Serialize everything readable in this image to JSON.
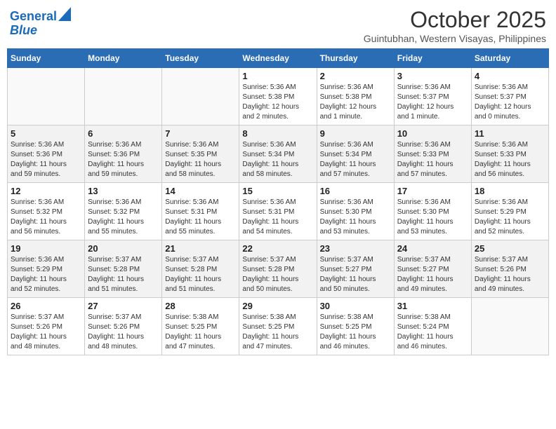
{
  "header": {
    "logo_line1": "General",
    "logo_line2": "Blue",
    "month": "October 2025",
    "location": "Guintubhan, Western Visayas, Philippines"
  },
  "weekdays": [
    "Sunday",
    "Monday",
    "Tuesday",
    "Wednesday",
    "Thursday",
    "Friday",
    "Saturday"
  ],
  "weeks": [
    [
      {
        "day": "",
        "info": ""
      },
      {
        "day": "",
        "info": ""
      },
      {
        "day": "",
        "info": ""
      },
      {
        "day": "1",
        "info": "Sunrise: 5:36 AM\nSunset: 5:38 PM\nDaylight: 12 hours\nand 2 minutes."
      },
      {
        "day": "2",
        "info": "Sunrise: 5:36 AM\nSunset: 5:38 PM\nDaylight: 12 hours\nand 1 minute."
      },
      {
        "day": "3",
        "info": "Sunrise: 5:36 AM\nSunset: 5:37 PM\nDaylight: 12 hours\nand 1 minute."
      },
      {
        "day": "4",
        "info": "Sunrise: 5:36 AM\nSunset: 5:37 PM\nDaylight: 12 hours\nand 0 minutes."
      }
    ],
    [
      {
        "day": "5",
        "info": "Sunrise: 5:36 AM\nSunset: 5:36 PM\nDaylight: 11 hours\nand 59 minutes."
      },
      {
        "day": "6",
        "info": "Sunrise: 5:36 AM\nSunset: 5:36 PM\nDaylight: 11 hours\nand 59 minutes."
      },
      {
        "day": "7",
        "info": "Sunrise: 5:36 AM\nSunset: 5:35 PM\nDaylight: 11 hours\nand 58 minutes."
      },
      {
        "day": "8",
        "info": "Sunrise: 5:36 AM\nSunset: 5:34 PM\nDaylight: 11 hours\nand 58 minutes."
      },
      {
        "day": "9",
        "info": "Sunrise: 5:36 AM\nSunset: 5:34 PM\nDaylight: 11 hours\nand 57 minutes."
      },
      {
        "day": "10",
        "info": "Sunrise: 5:36 AM\nSunset: 5:33 PM\nDaylight: 11 hours\nand 57 minutes."
      },
      {
        "day": "11",
        "info": "Sunrise: 5:36 AM\nSunset: 5:33 PM\nDaylight: 11 hours\nand 56 minutes."
      }
    ],
    [
      {
        "day": "12",
        "info": "Sunrise: 5:36 AM\nSunset: 5:32 PM\nDaylight: 11 hours\nand 56 minutes."
      },
      {
        "day": "13",
        "info": "Sunrise: 5:36 AM\nSunset: 5:32 PM\nDaylight: 11 hours\nand 55 minutes."
      },
      {
        "day": "14",
        "info": "Sunrise: 5:36 AM\nSunset: 5:31 PM\nDaylight: 11 hours\nand 55 minutes."
      },
      {
        "day": "15",
        "info": "Sunrise: 5:36 AM\nSunset: 5:31 PM\nDaylight: 11 hours\nand 54 minutes."
      },
      {
        "day": "16",
        "info": "Sunrise: 5:36 AM\nSunset: 5:30 PM\nDaylight: 11 hours\nand 53 minutes."
      },
      {
        "day": "17",
        "info": "Sunrise: 5:36 AM\nSunset: 5:30 PM\nDaylight: 11 hours\nand 53 minutes."
      },
      {
        "day": "18",
        "info": "Sunrise: 5:36 AM\nSunset: 5:29 PM\nDaylight: 11 hours\nand 52 minutes."
      }
    ],
    [
      {
        "day": "19",
        "info": "Sunrise: 5:36 AM\nSunset: 5:29 PM\nDaylight: 11 hours\nand 52 minutes."
      },
      {
        "day": "20",
        "info": "Sunrise: 5:37 AM\nSunset: 5:28 PM\nDaylight: 11 hours\nand 51 minutes."
      },
      {
        "day": "21",
        "info": "Sunrise: 5:37 AM\nSunset: 5:28 PM\nDaylight: 11 hours\nand 51 minutes."
      },
      {
        "day": "22",
        "info": "Sunrise: 5:37 AM\nSunset: 5:28 PM\nDaylight: 11 hours\nand 50 minutes."
      },
      {
        "day": "23",
        "info": "Sunrise: 5:37 AM\nSunset: 5:27 PM\nDaylight: 11 hours\nand 50 minutes."
      },
      {
        "day": "24",
        "info": "Sunrise: 5:37 AM\nSunset: 5:27 PM\nDaylight: 11 hours\nand 49 minutes."
      },
      {
        "day": "25",
        "info": "Sunrise: 5:37 AM\nSunset: 5:26 PM\nDaylight: 11 hours\nand 49 minutes."
      }
    ],
    [
      {
        "day": "26",
        "info": "Sunrise: 5:37 AM\nSunset: 5:26 PM\nDaylight: 11 hours\nand 48 minutes."
      },
      {
        "day": "27",
        "info": "Sunrise: 5:37 AM\nSunset: 5:26 PM\nDaylight: 11 hours\nand 48 minutes."
      },
      {
        "day": "28",
        "info": "Sunrise: 5:38 AM\nSunset: 5:25 PM\nDaylight: 11 hours\nand 47 minutes."
      },
      {
        "day": "29",
        "info": "Sunrise: 5:38 AM\nSunset: 5:25 PM\nDaylight: 11 hours\nand 47 minutes."
      },
      {
        "day": "30",
        "info": "Sunrise: 5:38 AM\nSunset: 5:25 PM\nDaylight: 11 hours\nand 46 minutes."
      },
      {
        "day": "31",
        "info": "Sunrise: 5:38 AM\nSunset: 5:24 PM\nDaylight: 11 hours\nand 46 minutes."
      },
      {
        "day": "",
        "info": ""
      }
    ]
  ]
}
